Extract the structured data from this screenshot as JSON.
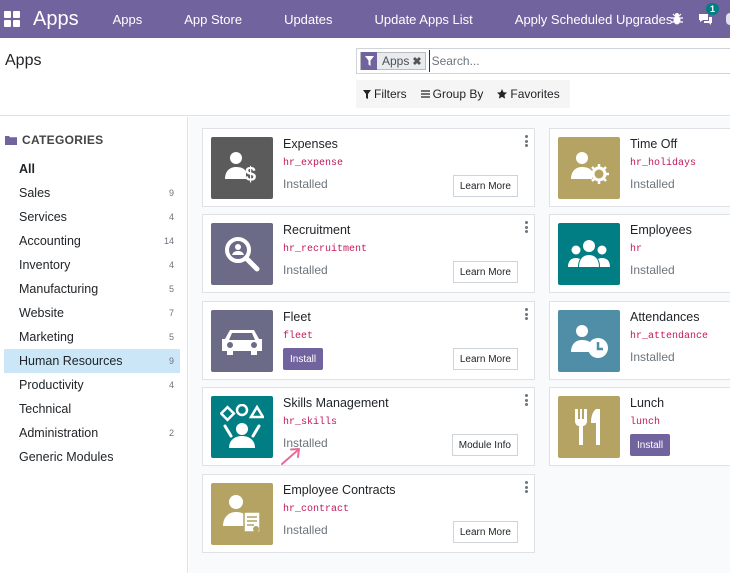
{
  "navbar": {
    "brand": "Apps",
    "menu": [
      "Apps",
      "App Store",
      "Updates",
      "Update Apps List",
      "Apply Scheduled Upgrades"
    ],
    "messages_count": "1",
    "icons": [
      "apps-grid-icon",
      "bug-icon",
      "chat-icon"
    ]
  },
  "control": {
    "breadcrumb": "Apps",
    "facet_label": "Apps",
    "facet_remove": "✖",
    "search_placeholder": "Search...",
    "filters_label": "Filters",
    "groupby_label": "Group By",
    "favorites_label": "Favorites"
  },
  "sidebar": {
    "header": "CATEGORIES",
    "items": [
      {
        "label": "All",
        "count": ""
      },
      {
        "label": "Sales",
        "count": "9"
      },
      {
        "label": "Services",
        "count": "4"
      },
      {
        "label": "Accounting",
        "count": "14"
      },
      {
        "label": "Inventory",
        "count": "4"
      },
      {
        "label": "Manufacturing",
        "count": "5"
      },
      {
        "label": "Website",
        "count": "7"
      },
      {
        "label": "Marketing",
        "count": "5"
      },
      {
        "label": "Human Resources",
        "count": "9"
      },
      {
        "label": "Productivity",
        "count": "4"
      },
      {
        "label": "Technical",
        "count": ""
      },
      {
        "label": "Administration",
        "count": "2"
      },
      {
        "label": "Generic Modules",
        "count": ""
      }
    ]
  },
  "apps": [
    {
      "title": "Expenses",
      "tech": "hr_expense",
      "status": "Installed",
      "action": "Learn More",
      "color": "#5b5b5b",
      "icon": "expense-icon"
    },
    {
      "title": "Time Off",
      "tech": "hr_holidays",
      "status": "Installed",
      "action": "",
      "color": "#b4a363",
      "icon": "time-off-icon"
    },
    {
      "title": "Recruitment",
      "tech": "hr_recruitment",
      "status": "Installed",
      "action": "Learn More",
      "color": "#6b6b87",
      "icon": "recruitment-icon"
    },
    {
      "title": "Employees",
      "tech": "hr",
      "status": "Installed",
      "action": "",
      "color": "#017e84",
      "icon": "employees-icon"
    },
    {
      "title": "Fleet",
      "tech": "fleet",
      "status": "",
      "install": "Install",
      "action": "Learn More",
      "color": "#6b6b87",
      "icon": "car-icon"
    },
    {
      "title": "Attendances",
      "tech": "hr_attendance",
      "status": "Installed",
      "action": "",
      "color": "#4f8ea6",
      "icon": "attendance-icon"
    },
    {
      "title": "Skills Management",
      "tech": "hr_skills",
      "status": "Installed",
      "action": "Module Info",
      "color": "#017e84",
      "icon": "skills-icon"
    },
    {
      "title": "Lunch",
      "tech": "lunch",
      "status": "",
      "install": "Install",
      "action": "",
      "color": "#b4a363",
      "icon": "lunch-icon"
    },
    {
      "title": "Employee Contracts",
      "tech": "hr_contract",
      "status": "Installed",
      "action": "Learn More",
      "color": "#b4a363",
      "icon": "contract-icon"
    }
  ],
  "colors": {
    "brand": "#71639e",
    "active_category": "#cbe7f7",
    "technical_name": "#c2185b",
    "badge": "#017e84",
    "annotation_arrow": "#e86a9a"
  }
}
